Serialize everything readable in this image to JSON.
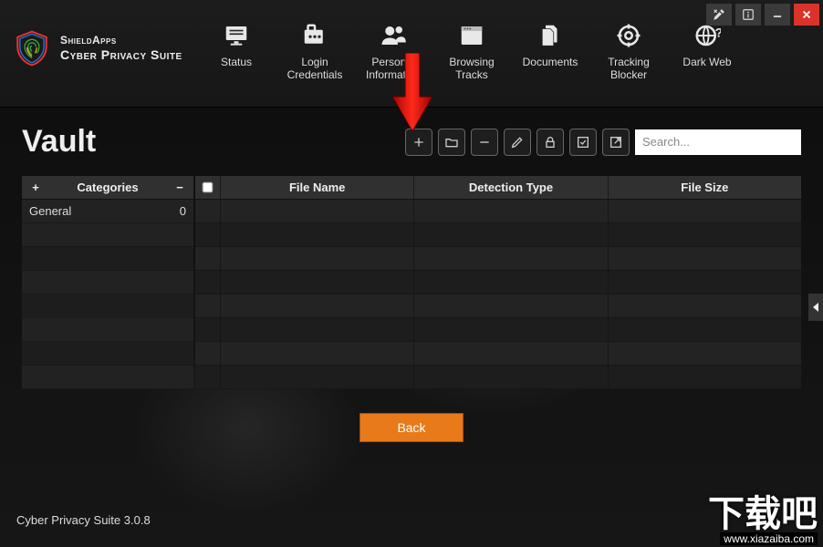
{
  "brand": {
    "line1": "ShieldApps",
    "line2": "Cyber Privacy Suite"
  },
  "nav": {
    "status": "Status",
    "login": "Login Credentials",
    "personal": "Personal Information",
    "browsing": "Browsing Tracks",
    "documents": "Documents",
    "tracking": "Tracking Blocker",
    "darkweb": "Dark Web"
  },
  "page": {
    "title": "Vault"
  },
  "toolbar": {
    "search_placeholder": "Search..."
  },
  "categories": {
    "header": "Categories",
    "items": [
      {
        "name": "General",
        "count": "0"
      }
    ]
  },
  "grid": {
    "headers": {
      "filename": "File Name",
      "detection": "Detection Type",
      "filesize": "File Size"
    }
  },
  "buttons": {
    "back": "Back"
  },
  "footer": {
    "version": "Cyber Privacy Suite 3.0.8"
  },
  "watermark": {
    "cn": "下载吧",
    "url": "www.xiazaiba.com"
  }
}
